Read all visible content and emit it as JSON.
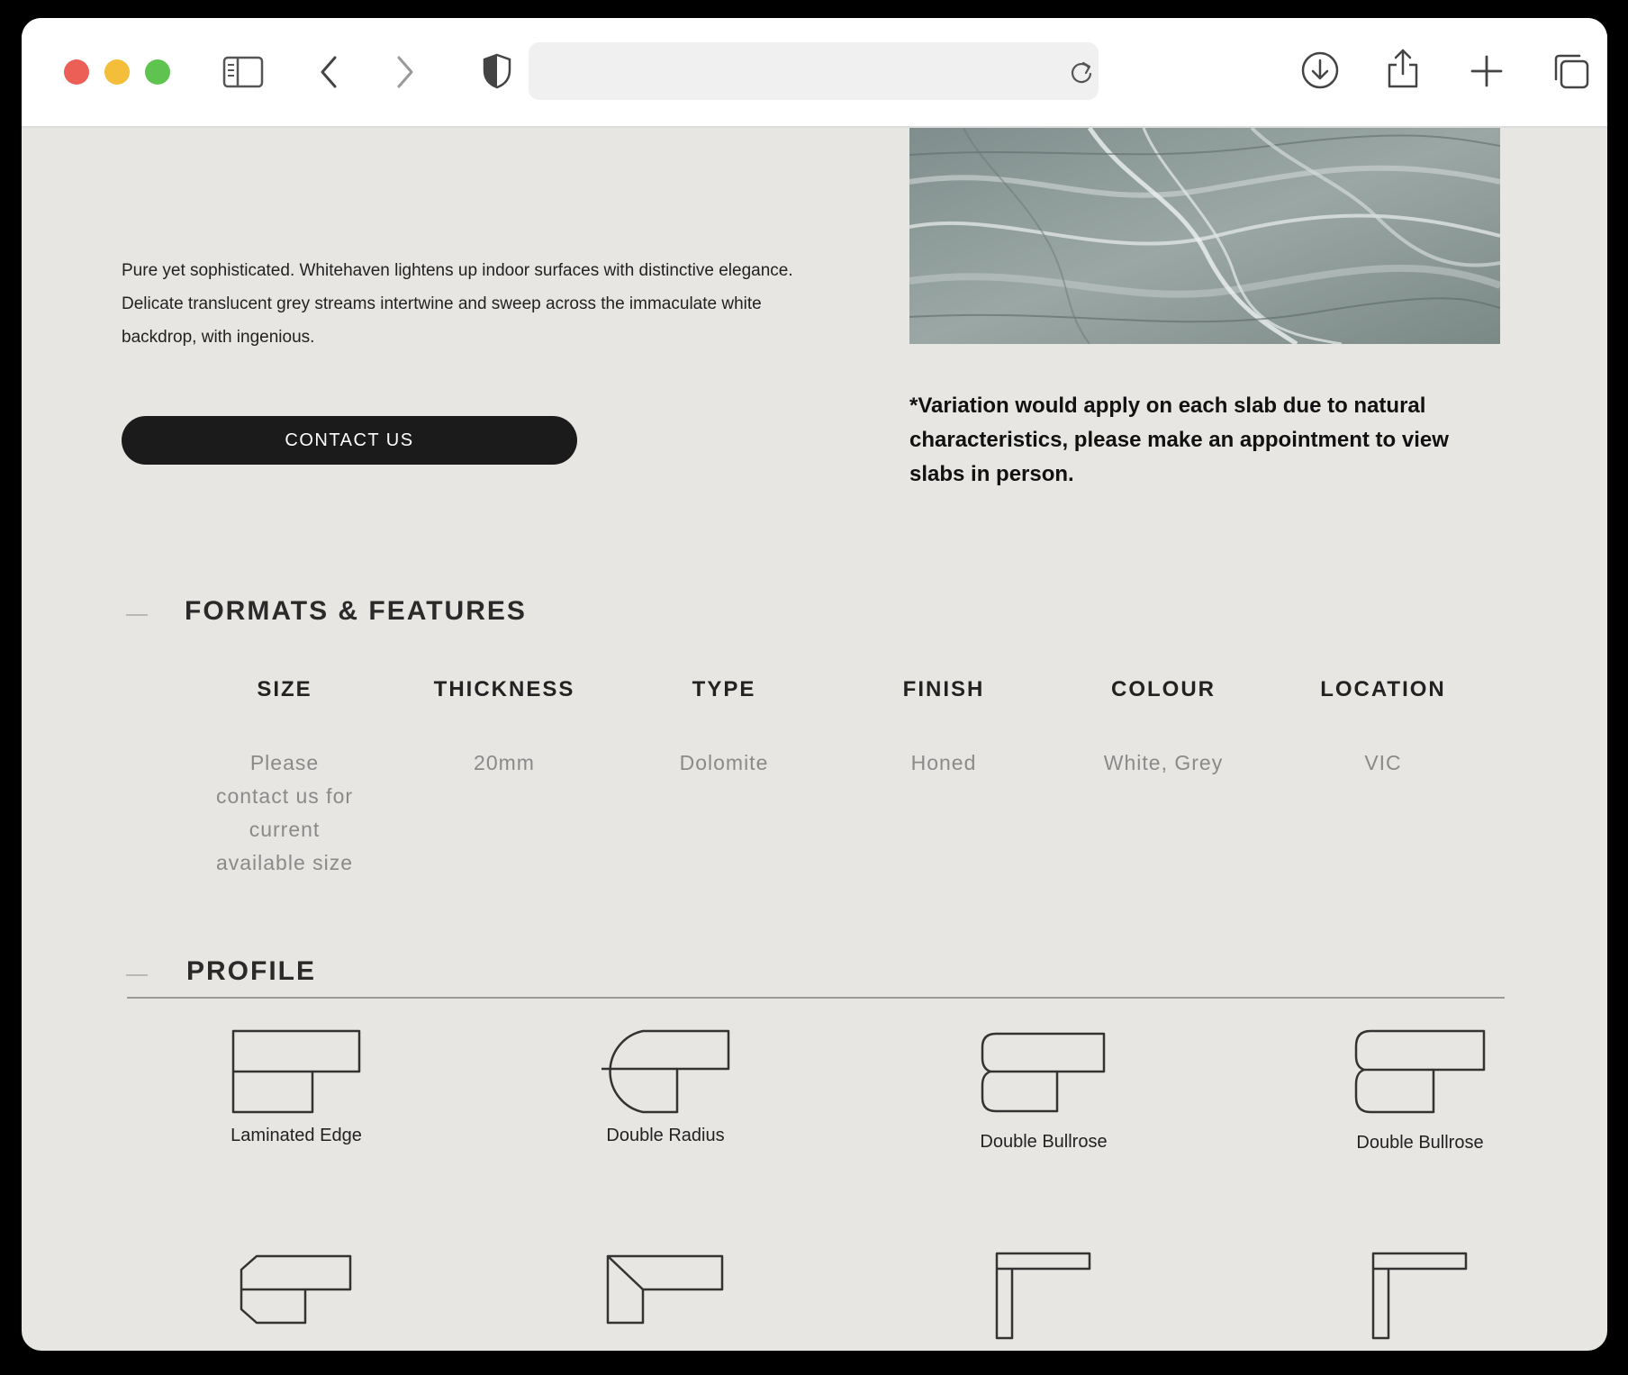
{
  "browser": {
    "url": "",
    "icons": [
      "sidebar-icon",
      "back-icon",
      "forward-icon",
      "shield-icon",
      "reload-icon",
      "download-icon",
      "share-icon",
      "plus-icon",
      "tabs-icon"
    ]
  },
  "hero": {
    "description": "Pure yet sophisticated. Whitehaven lightens up indoor surfaces with distinctive elegance. Delicate translucent grey streams intertwine and sweep across the immaculate white backdrop, with ingenious.",
    "contact_label": "CONTACT US",
    "variation_note": "*Variation would apply on each slab due to natural characteristics, please make an appointment to view slabs in person."
  },
  "formats": {
    "title": "FORMATS & FEATURES",
    "columns": [
      {
        "head": "SIZE",
        "value": "Please contact us for current available size"
      },
      {
        "head": "THICKNESS",
        "value": "20mm"
      },
      {
        "head": "TYPE",
        "value": "Dolomite"
      },
      {
        "head": "FINISH",
        "value": "Honed"
      },
      {
        "head": "COLOUR",
        "value": "White, Grey"
      },
      {
        "head": "LOCATION",
        "value": "VIC"
      }
    ]
  },
  "profile": {
    "title": "PROFILE",
    "items": [
      {
        "label": "Laminated Edge"
      },
      {
        "label": "Double Radius"
      },
      {
        "label": "Double Bullrose"
      },
      {
        "label": "Double Bullrose"
      },
      {
        "label": ""
      },
      {
        "label": ""
      },
      {
        "label": ""
      },
      {
        "label": ""
      }
    ]
  }
}
